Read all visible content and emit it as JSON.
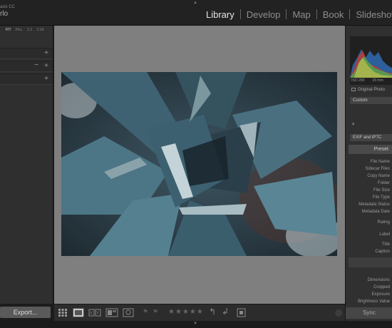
{
  "app": {
    "brand_line": "asic CC",
    "user_line": "rlo"
  },
  "modules": [
    "Library",
    "Develop",
    "Map",
    "Book",
    "Slideshow"
  ],
  "active_module": "Library",
  "left_panel": {
    "nav_options": [
      "FIT",
      "FILL",
      "1:1",
      "1:16"
    ],
    "rows": [
      {
        "controls": "+"
      },
      {
        "controls": "− +"
      },
      {
        "controls": "+"
      }
    ],
    "export_label": "Export..."
  },
  "toolbar": {
    "stars": "★★★★★",
    "icons": [
      "grid-view-icon",
      "loupe-view-icon",
      "compare-view-icon",
      "survey-view-icon",
      "people-view-icon",
      "flag-icon",
      "reject-flag-icon",
      "rotate-left-icon",
      "rotate-right-icon",
      "crop-icon"
    ]
  },
  "right_panel": {
    "histogram_info_left": "ISO 200",
    "histogram_info_right": "23 mm",
    "original_photo": "Original Photo",
    "quick_develop_preset": "Custom",
    "metadata_preset": "EXIF and IPTC",
    "preset_header": "Preset",
    "metadata_fields": [
      "File Name",
      "Sidecar Files",
      "Copy Name",
      "Folder",
      "File Size",
      "File Type",
      "Metadata Status",
      "Metadata Date",
      "Rating",
      "Label",
      "Title",
      "Caption",
      "Dimensions",
      "Cropped",
      "Exposure",
      "Brightness Value"
    ],
    "sync_label": "Sync"
  },
  "colors": {
    "accent_text": "#e6e6e6",
    "panel": "#2f2f2f",
    "canvas": "#7f7f7f"
  }
}
